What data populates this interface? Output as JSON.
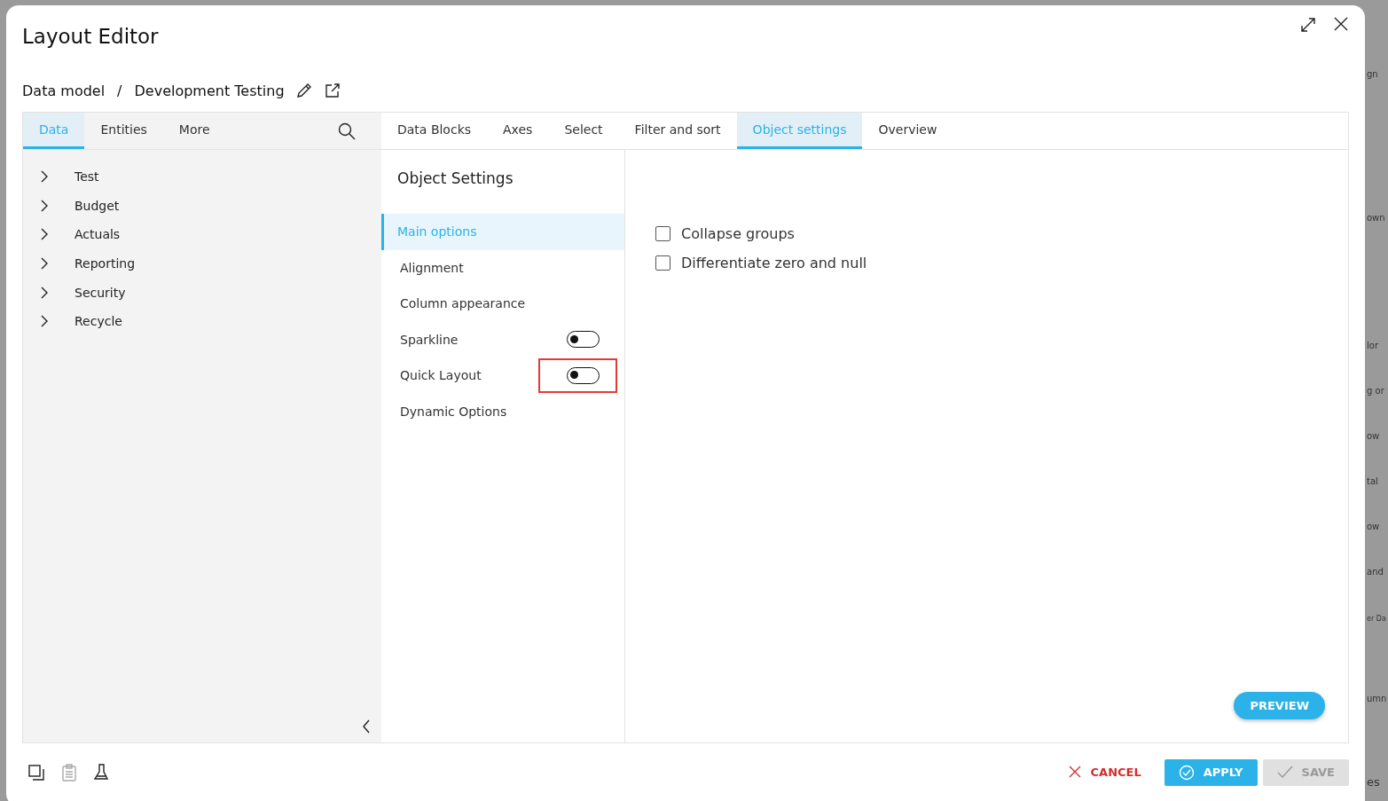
{
  "background": {
    "fragments": [
      "gn",
      "own",
      "lor",
      "g or",
      "ow",
      "tal",
      "ow",
      "and",
      "er Da",
      "umn",
      "es"
    ]
  },
  "window": {
    "title": "Layout Editor"
  },
  "breadcrumb": {
    "items": [
      "Data model",
      "Development Testing"
    ],
    "separator": "/"
  },
  "left_panel": {
    "tabs": [
      {
        "label": "Data",
        "selected": true
      },
      {
        "label": "Entities",
        "selected": false
      },
      {
        "label": "More",
        "selected": false
      }
    ],
    "tree": [
      {
        "label": "Test",
        "expanded": false
      },
      {
        "label": "Budget",
        "expanded": false
      },
      {
        "label": "Actuals",
        "expanded": false
      },
      {
        "label": "Reporting",
        "expanded": false
      },
      {
        "label": "Security",
        "expanded": false
      },
      {
        "label": "Recycle",
        "expanded": false
      }
    ]
  },
  "main_tabs": [
    {
      "label": "Data Blocks",
      "selected": false
    },
    {
      "label": "Axes",
      "selected": false
    },
    {
      "label": "Select",
      "selected": false
    },
    {
      "label": "Filter and sort",
      "selected": false
    },
    {
      "label": "Object settings",
      "selected": true
    },
    {
      "label": "Overview",
      "selected": false
    }
  ],
  "section_title": "Object Settings",
  "options_nav": [
    {
      "label": "Main options",
      "kind": "link",
      "selected": true
    },
    {
      "label": "Alignment",
      "kind": "link",
      "selected": false
    },
    {
      "label": "Column appearance",
      "kind": "link",
      "selected": false
    },
    {
      "label": "Sparkline",
      "kind": "toggle",
      "selected": false,
      "on": false,
      "highlighted": false
    },
    {
      "label": "Quick Layout",
      "kind": "toggle",
      "selected": false,
      "on": false,
      "highlighted": true
    },
    {
      "label": "Dynamic Options",
      "kind": "link",
      "selected": false
    }
  ],
  "checkboxes": [
    {
      "label": "Collapse groups",
      "checked": false
    },
    {
      "label": "Differentiate zero and null",
      "checked": false
    }
  ],
  "preview_button": "PREVIEW",
  "footer": {
    "buttons": [
      {
        "label": "CANCEL",
        "kind": "cancel",
        "disabled": false
      },
      {
        "label": "APPLY",
        "kind": "apply",
        "disabled": false
      },
      {
        "label": "SAVE",
        "kind": "save",
        "disabled": true
      }
    ]
  }
}
